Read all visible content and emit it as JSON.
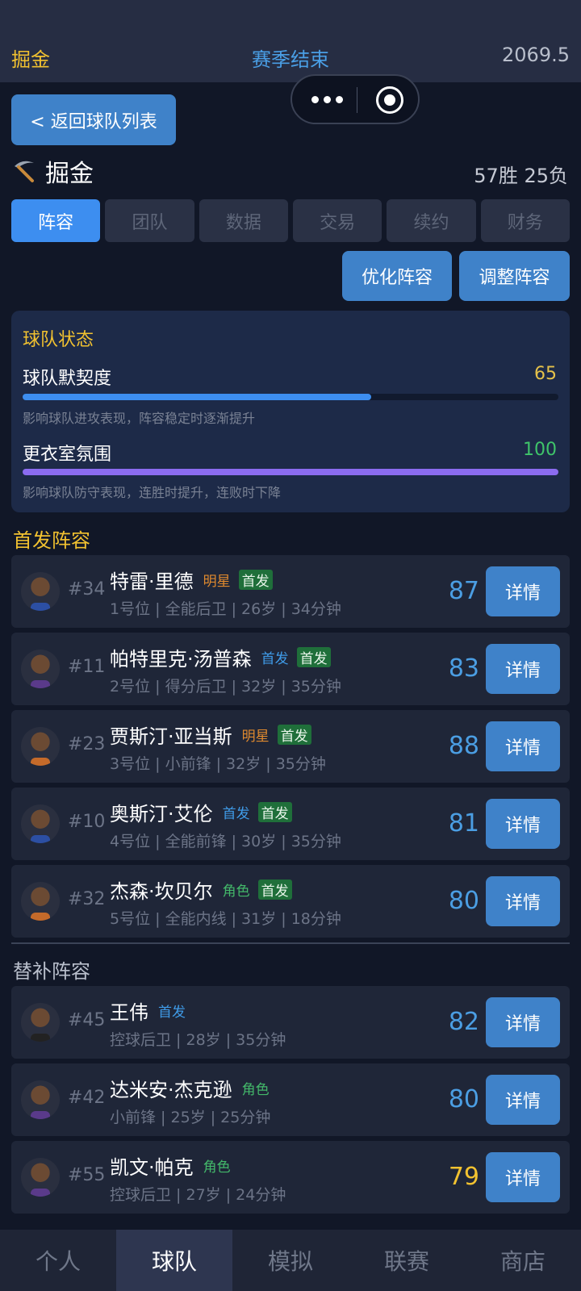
{
  "header": {
    "team": "掘金",
    "status": "赛季结束",
    "money": "2069.5"
  },
  "nav": {
    "back_label": "< 返回球队列表"
  },
  "team": {
    "name": "掘金",
    "record": "57胜 25负"
  },
  "tabs": [
    "阵容",
    "团队",
    "数据",
    "交易",
    "续约",
    "财务"
  ],
  "actions": {
    "optimize": "优化阵容",
    "adjust": "调整阵容"
  },
  "status": {
    "title": "球队状态",
    "chemistry": {
      "label": "球队默契度",
      "value": "65",
      "level": 0.65,
      "desc": "影响球队进攻表现，阵容稳定时逐渐提升",
      "color": "#3d8ef0"
    },
    "morale": {
      "label": "更衣室氛围",
      "value": "100",
      "level": 1.0,
      "desc": "影响球队防守表现，连胜时提升，连败时下降",
      "color": "#8b6cf0"
    }
  },
  "starters": {
    "title": "首发阵容",
    "players": [
      {
        "number": "#34",
        "name": "特雷·里德",
        "tag": "明星",
        "badge": "首发",
        "meta": "1号位 | 全能后卫 | 26岁 | 34分钟",
        "rating": "87",
        "detail": "详情"
      },
      {
        "number": "#11",
        "name": "帕特里克·汤普森",
        "tag": "首发",
        "badge": "首发",
        "meta": "2号位 | 得分后卫 | 32岁 | 35分钟",
        "rating": "83",
        "detail": "详情"
      },
      {
        "number": "#23",
        "name": "贾斯汀·亚当斯",
        "tag": "明星",
        "badge": "首发",
        "meta": "3号位 | 小前锋 | 32岁 | 35分钟",
        "rating": "88",
        "detail": "详情"
      },
      {
        "number": "#10",
        "name": "奥斯汀·艾伦",
        "tag": "首发",
        "badge": "首发",
        "meta": "4号位 | 全能前锋 | 30岁 | 35分钟",
        "rating": "81",
        "detail": "详情"
      },
      {
        "number": "#32",
        "name": "杰森·坎贝尔",
        "tag": "角色",
        "badge": "首发",
        "meta": "5号位 | 全能内线 | 31岁 | 18分钟",
        "rating": "80",
        "detail": "详情"
      }
    ]
  },
  "bench": {
    "title": "替补阵容",
    "players": [
      {
        "number": "#45",
        "name": "王伟",
        "tag": "首发",
        "meta": "控球后卫 | 28岁 | 35分钟",
        "rating": "82",
        "detail": "详情"
      },
      {
        "number": "#42",
        "name": "达米安·杰克逊",
        "tag": "角色",
        "meta": "小前锋 | 25岁 | 25分钟",
        "rating": "80",
        "detail": "详情"
      },
      {
        "number": "#55",
        "name": "凯文·帕克",
        "tag": "角色",
        "meta": "控球后卫 | 27岁 | 24分钟",
        "rating": "79",
        "detail": "详情"
      }
    ]
  },
  "bottom_nav": [
    "个人",
    "球队",
    "模拟",
    "联赛",
    "商店"
  ]
}
